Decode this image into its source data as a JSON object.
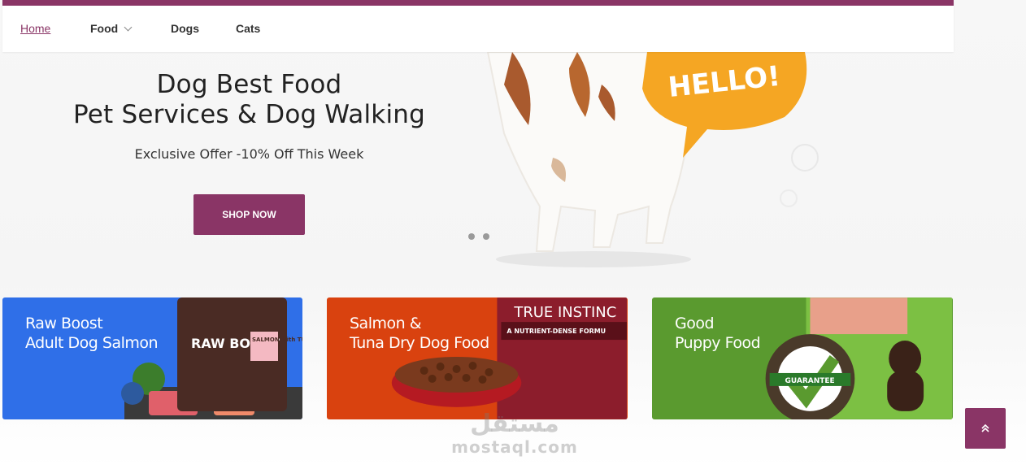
{
  "nav": {
    "items": [
      {
        "label": "Home"
      },
      {
        "label": "Food"
      },
      {
        "label": "Dogs"
      },
      {
        "label": "Cats"
      }
    ]
  },
  "hero": {
    "title_line1": "Dog Best Food",
    "title_line2": "Pet Services & Dog Walking",
    "subtitle": "Exclusive Offer -10% Off This Week",
    "button_label": "SHOP NOW",
    "bubble_text": "HELLO!"
  },
  "cards": [
    {
      "line1": "Raw Boost",
      "line2": "Adult Dog Salmon",
      "color": "#2f6fe8",
      "pack_brand": "RAW BOOST",
      "pack_flavor": "SALMON with TUNA"
    },
    {
      "line1": "Salmon &",
      "line2": "Tuna Dry Dog Food",
      "color": "#d9420f",
      "pack_brand": "TRUE INSTINC",
      "pack_flavor": "A NUTRIENT-DENSE FORMU"
    },
    {
      "line1": "Good",
      "line2": "Puppy Food",
      "color": "#5a9a2f",
      "badge_text": "GUARANTEE"
    }
  ],
  "watermark": {
    "arabic": "مستقل",
    "latin": "mostaql.com"
  },
  "colors": {
    "brand": "#8a3566",
    "speech_bubble": "#f5a623"
  },
  "icons": {
    "food_dropdown": "chevron-down-icon",
    "scroll_top": "double-chevron-up-icon"
  }
}
